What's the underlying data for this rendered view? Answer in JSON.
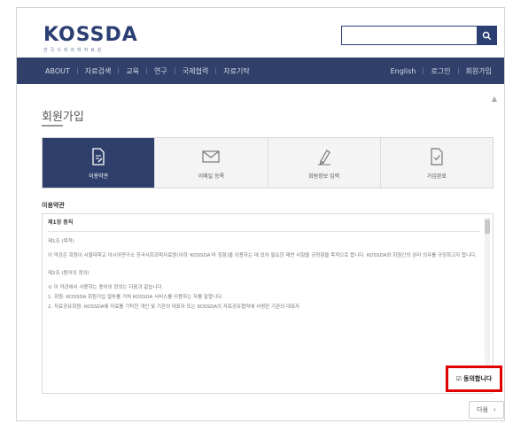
{
  "header": {
    "logo_main": "KOSSDA",
    "logo_sub": "한국사회과학자료원",
    "search": {
      "value": "",
      "placeholder": ""
    }
  },
  "nav": {
    "left": [
      "ABOUT",
      "자료검색",
      "교육",
      "연구",
      "국제협력",
      "자료기탁"
    ],
    "right": [
      "English",
      "로그인",
      "회원가입"
    ]
  },
  "page": {
    "title": "회원가입"
  },
  "steps": [
    {
      "label": "이용약관",
      "icon": "document-edit-icon",
      "active": true
    },
    {
      "label": "이메일 등록",
      "icon": "envelope-icon",
      "active": false
    },
    {
      "label": "회원정보 입력",
      "icon": "pencil-icon",
      "active": false
    },
    {
      "label": "가입완료",
      "icon": "document-check-icon",
      "active": false
    }
  ],
  "section_label": "이용약관",
  "terms": {
    "chapter": "제1장 총칙",
    "article1_title": "제1조 (목적)",
    "article1_body": "이 약관은 회원이 서울대학교 아시아연구소 한국사회과학자료원(이하 'KOSSDA'라 칭함)을 이용하는 데 있어 필요한 제반 사항을 규정함을 목적으로 합니다. KOSSDA와 회원간의 권리 의무를 규정하고자 합니다.",
    "article2_title": "제2조 (용어의 정의)",
    "article2_lines": [
      "① 이 약관에서 사용하는 용어의 정의는 다음과 같습니다.",
      "1. 회원: KOSSDA 회원가입 절차를 거쳐 KOSSDA 서비스를 이용하는 자를 말합니다.",
      "2. 자료공유회원: KOSSDA에 자료를 기탁한 개인 및 기관의 대표자 또는 KOSSDA의 자료공유협약에 서명한 기관의 대표자"
    ]
  },
  "agree_label": "동의합니다",
  "next_label": "다음",
  "colors": {
    "navy": "#30406a",
    "highlight": "#e00000"
  }
}
